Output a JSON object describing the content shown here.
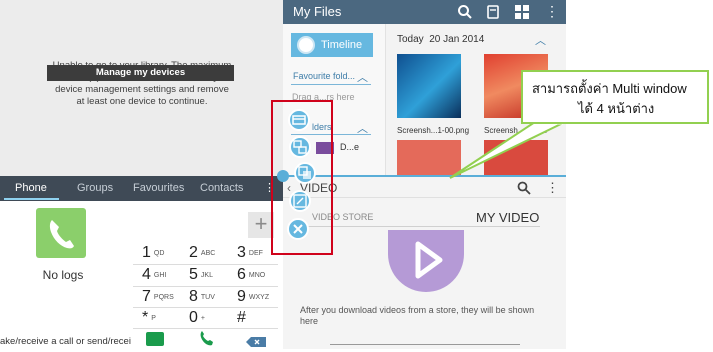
{
  "library_pane": {
    "message": "Unable to go to your library. The maximum account (5) has been reached. Check your device management settings and remove at least one device to continue.",
    "toast": "Manage my devices"
  },
  "phone": {
    "tabs": [
      {
        "label": "Phone",
        "active": true
      },
      {
        "label": "Groups",
        "active": false
      },
      {
        "label": "Favourites",
        "active": false
      },
      {
        "label": "Contacts",
        "active": false
      }
    ],
    "no_logs": "No logs",
    "plus": "+",
    "footer_text": "ake/receive a call or send/recei",
    "keys": [
      {
        "digit": "1",
        "letters": "QD"
      },
      {
        "digit": "2",
        "letters": "ABC"
      },
      {
        "digit": "3",
        "letters": "DEF"
      },
      {
        "digit": "4",
        "letters": "GHI"
      },
      {
        "digit": "5",
        "letters": "JKL"
      },
      {
        "digit": "6",
        "letters": "MNO"
      },
      {
        "digit": "7",
        "letters": "PQRS"
      },
      {
        "digit": "8",
        "letters": "TUV"
      },
      {
        "digit": "9",
        "letters": "WXYZ"
      },
      {
        "digit": "*",
        "letters": "P"
      },
      {
        "digit": "0",
        "letters": "+"
      },
      {
        "digit": "#",
        "letters": ""
      }
    ],
    "accent_color": "#8bcf6b"
  },
  "files": {
    "title": "My Files",
    "timeline_label": "Timeline",
    "favourite_folders": "Favourite fold...",
    "drag_hint": "Drag a...rs here",
    "folders_head": "lders",
    "folder_item": "D...e",
    "today_label": "Today",
    "today_date": "20 Jan 2014",
    "thumbnails": [
      {
        "caption": "Screensh...1-00.png"
      },
      {
        "caption": "Screensh...8-22..."
      }
    ],
    "header_color": "#4b6880"
  },
  "video": {
    "title": "VIDEO",
    "tab_store": "VIDEO STORE",
    "tab_my": "MY VIDEO",
    "message": "After you download videos from a store, they will be shown here",
    "accent_color": "#b59ad6"
  },
  "callout": {
    "line1": "สามารถตั้งค่า Multi window",
    "line2": "ได้ 4 หน้าต่าง"
  },
  "multiwindow_buttons": [
    {
      "icon": "window-switch-icon"
    },
    {
      "icon": "swap-windows-icon"
    },
    {
      "icon": "drag-content-icon"
    },
    {
      "icon": "maximize-icon"
    },
    {
      "icon": "close-icon"
    }
  ]
}
